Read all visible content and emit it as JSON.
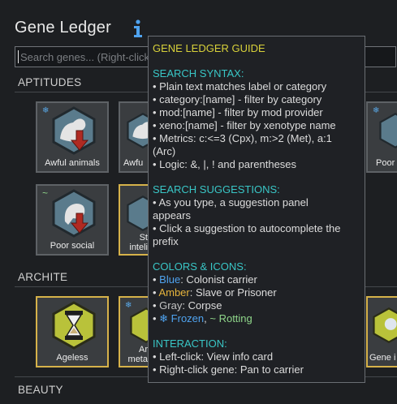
{
  "header": {
    "title": "Gene Ledger"
  },
  "search": {
    "placeholder": "Search genes... (Right-click for help)"
  },
  "sections": {
    "aptitudes": "APTITUDES",
    "archite": "ARCHITE",
    "beauty": "BEAUTY"
  },
  "cards": {
    "awful_animals": "Awful animals",
    "awful_partial": "Awfu",
    "poor_partial": "Poor",
    "poor_social": "Poor social",
    "st_inteli_line1": "St",
    "st_inteli_line2": "inteli",
    "ageless": "Ageless",
    "ar_meta_line1": "Ar",
    "ar_meta_line2": "meta",
    "gene_partial": "Gene i"
  },
  "tooltip": {
    "title": "GENE LEDGER GUIDE",
    "search_syntax": {
      "heading": "SEARCH SYNTAX:",
      "lines": [
        "• Plain text matches label or category",
        "• category:[name] - filter by category",
        "• mod:[name] - filter by mod provider",
        "• xeno:[name] - filter by xenotype name",
        "• Metrics: c:<=3 (Cpx), m:>2 (Met), a:1",
        "(Arc)",
        "• Logic: &, |, ! and parentheses"
      ]
    },
    "suggestions": {
      "heading": "SEARCH SUGGESTIONS:",
      "lines": [
        "• As you type, a suggestion panel",
        "appears",
        "• Click a suggestion to autocomplete the",
        "prefix"
      ]
    },
    "colors": {
      "heading": "COLORS & ICONS:",
      "bullet": "• ",
      "blue_word": "Blue",
      "blue_rest": ": Colonist carrier",
      "amber_word": "Amber",
      "amber_rest": ": Slave or Prisoner",
      "gray_word": "Gray",
      "gray_rest": ": Corpse",
      "frozen_text": "❄ Frozen",
      "comma": ", ",
      "rotting_text": "~ Rotting"
    },
    "interaction": {
      "heading": "INTERACTION:",
      "lines": [
        "• Left-click: View info card",
        "• Right-click gene: Pan to carrier"
      ]
    }
  },
  "colors": {
    "accent_yellow": "#d8d13a",
    "heading_cyan": "#39c6c6",
    "blue": "#4fa3ef",
    "amber": "#e6b43c",
    "green": "#8fd68a",
    "gold_border": "#d6b24a"
  },
  "icons": {
    "info": "info-icon",
    "snowflake": "snowflake-icon",
    "hourglass": "hourglass-icon"
  }
}
